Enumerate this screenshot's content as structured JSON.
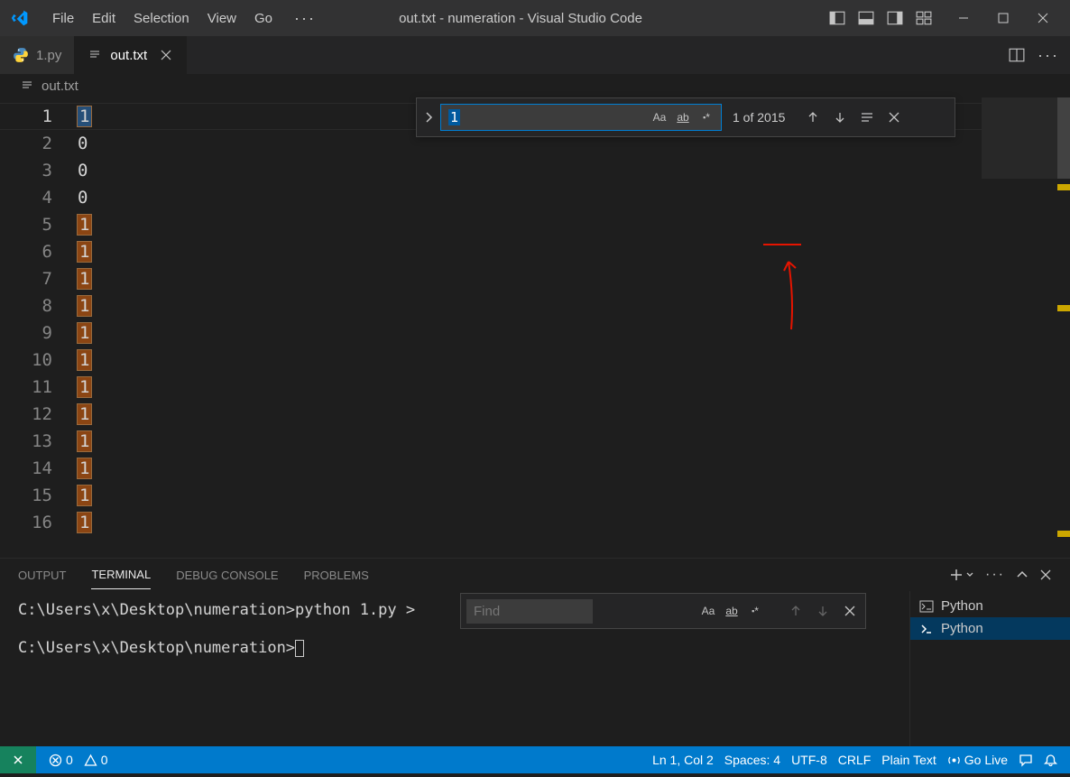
{
  "menu": {
    "file": "File",
    "edit": "Edit",
    "selection": "Selection",
    "view": "View",
    "go": "Go",
    "more": "···"
  },
  "title": "out.txt - numeration - Visual Studio Code",
  "tabs": [
    {
      "label": "1.py",
      "active": false,
      "icon": "python"
    },
    {
      "label": "out.txt",
      "active": true,
      "icon": "text"
    }
  ],
  "breadcrumb_file": "out.txt",
  "lines": [
    "1",
    "0",
    "0",
    "0",
    "1",
    "1",
    "1",
    "1",
    "1",
    "1",
    "1",
    "1",
    "1",
    "1",
    "1",
    "1"
  ],
  "find": {
    "query": "1",
    "count": "1 of 2015",
    "opt_case": "Aa",
    "opt_word": "ab",
    "opt_regex": "*"
  },
  "terminal_find_placeholder": "Find",
  "panel": {
    "output": "OUTPUT",
    "terminal": "TERMINAL",
    "debug": "DEBUG CONSOLE",
    "problems": "PROBLEMS"
  },
  "terminal": {
    "line1_prompt": "C:\\Users\\x\\Desktop\\numeration>",
    "line1_cmd": "python 1.py >",
    "line2_prompt": "C:\\Users\\x\\Desktop\\numeration>"
  },
  "terminal_side": {
    "python": "Python"
  },
  "status": {
    "errors": "0",
    "warnings": "0",
    "lncol": "Ln 1, Col 2",
    "spaces": "Spaces: 4",
    "encoding": "UTF-8",
    "eol": "CRLF",
    "lang": "Plain Text",
    "golive": "Go Live"
  }
}
